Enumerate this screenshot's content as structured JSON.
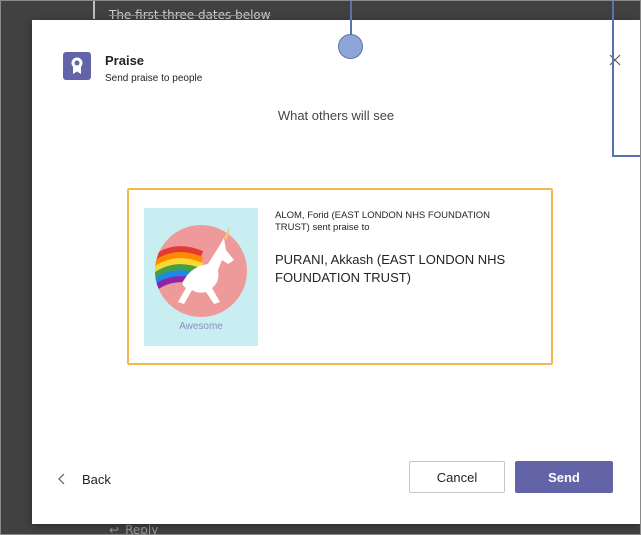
{
  "background": {
    "top_text": "The first three dates below",
    "reply_label": "Reply"
  },
  "dialog": {
    "app_title": "Praise",
    "app_subtitle": "Send praise to people",
    "close_icon": "close-icon",
    "preview_heading": "What others will see",
    "card": {
      "badge_label": "Awesome",
      "badge_icon": "unicorn-icon",
      "sender_text": "ALOM, Forid (EAST LONDON NHS FOUNDATION TRUST) sent praise to",
      "recipient_text": "PURANI, Akkash (EAST LONDON NHS FOUNDATION TRUST)",
      "border_color": "#f2b84b",
      "badge_bg_color": "#c9eef2"
    },
    "back_label": "Back",
    "cancel_label": "Cancel",
    "send_label": "Send"
  },
  "colors": {
    "brand": "#6264a7",
    "overlay": "#414141",
    "annotation": "#5a72b0"
  }
}
